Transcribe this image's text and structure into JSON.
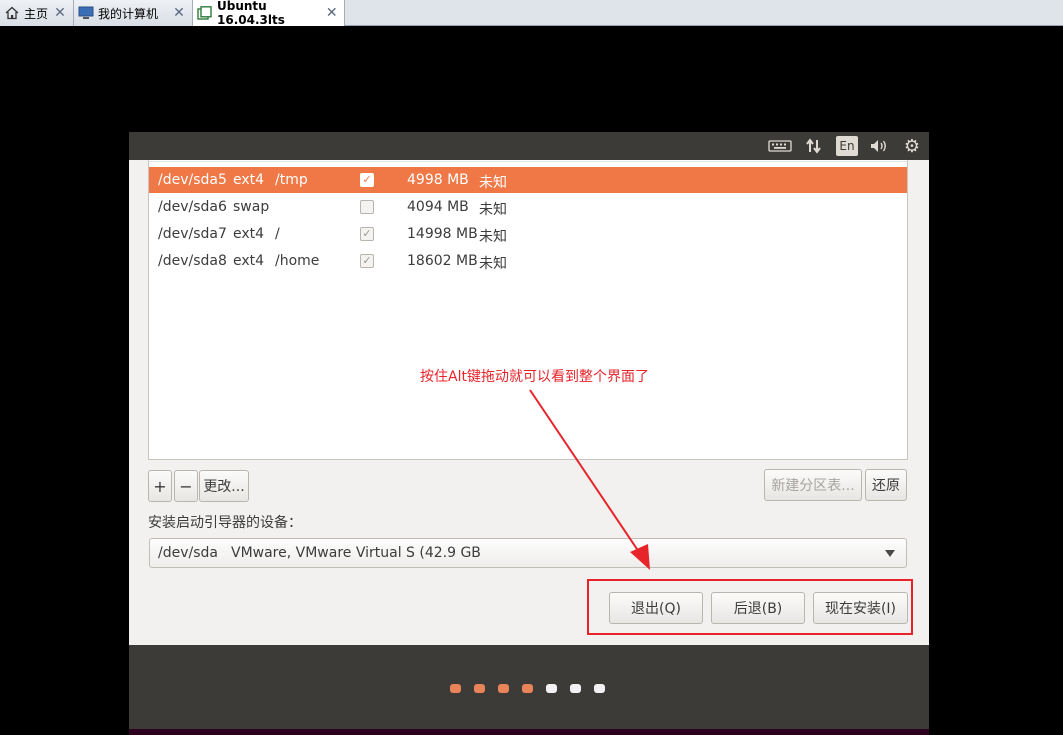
{
  "tabs": [
    {
      "label": "主页",
      "icon": "home-icon",
      "active": false
    },
    {
      "label": "我的计算机",
      "icon": "computer-icon",
      "active": false
    },
    {
      "label": "Ubuntu 16.04.3lts",
      "icon": "vm-icon",
      "active": true
    }
  ],
  "panel": {
    "indicators": [
      "keyboard-icon",
      "network-icon",
      "language-indicator",
      "volume-icon",
      "settings-gear-icon"
    ],
    "language": "En"
  },
  "partitions": [
    {
      "device": "/dev/sda5",
      "type": "ext4",
      "mount": "/tmp",
      "format": true,
      "size": "4998 MB",
      "used": "未知",
      "selected": true
    },
    {
      "device": "/dev/sda6",
      "type": "swap",
      "mount": "",
      "format": false,
      "size": "4094 MB",
      "used": "未知",
      "selected": false
    },
    {
      "device": "/dev/sda7",
      "type": "ext4",
      "mount": "/",
      "format": true,
      "size": "14998 MB",
      "used": "未知",
      "selected": false
    },
    {
      "device": "/dev/sda8",
      "type": "ext4",
      "mount": "/home",
      "format": true,
      "size": "18602 MB",
      "used": "未知",
      "selected": false
    }
  ],
  "toolbar": {
    "add": "+",
    "remove": "−",
    "change": "更改...",
    "new_table": "新建分区表...",
    "revert": "还原"
  },
  "bootloader": {
    "label": "安装启动引导器的设备：",
    "device": "/dev/sda",
    "description": "VMware, VMware Virtual S (42.9 GB"
  },
  "actions": {
    "quit": "退出(Q)",
    "back": "后退(B)",
    "install": "现在安装(I)"
  },
  "progress": {
    "total_steps": 7,
    "completed_steps": 4,
    "active_color": "#e9835a",
    "inactive_color": "#f2f2f2"
  },
  "annotation": {
    "text": "按住Alt键拖动就可以看到整个界面了",
    "color": "#e8242b"
  }
}
